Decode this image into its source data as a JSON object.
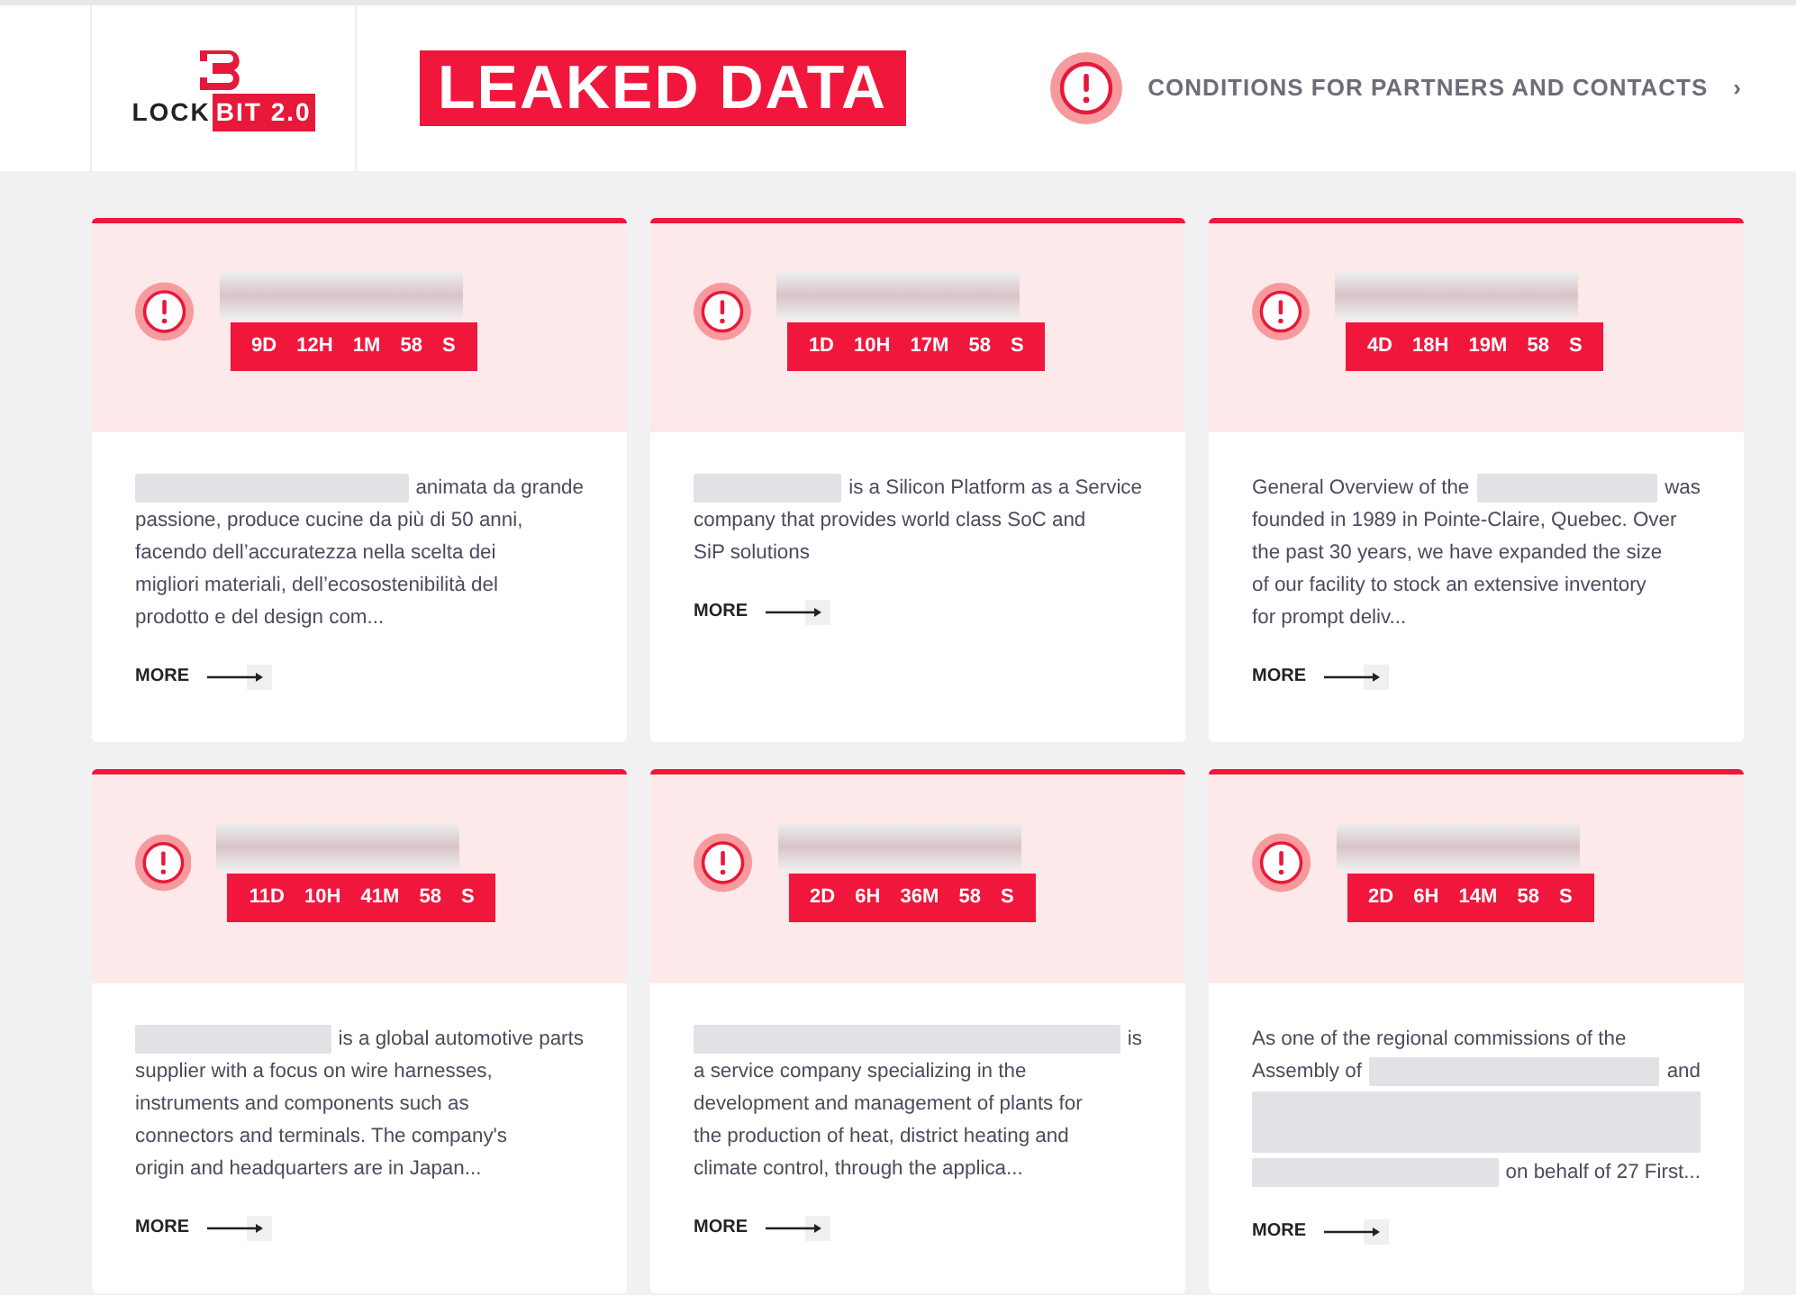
{
  "header": {
    "logo": {
      "text": "LOCK",
      "badge": "BIT 2.0"
    },
    "banner": "LEAKED DATA",
    "link": {
      "label": "CONDITIONS FOR PARTNERS AND CONTACTS",
      "chevron": "›"
    }
  },
  "cards": [
    {
      "timer": "9D 12H 1M 58 S",
      "lines": [
        [
          {
            "kind": "redacted"
          },
          {
            "kind": "text",
            "text": "animata da grande"
          }
        ],
        [
          {
            "kind": "text",
            "text": "passione, produce cucine da più di 50 anni,"
          }
        ],
        [
          {
            "kind": "text",
            "text": "facendo dell’accuratezza nella scelta dei"
          }
        ],
        [
          {
            "kind": "text",
            "text": "migliori materiali, dell’ecosostenibilità del"
          }
        ],
        [
          {
            "kind": "text",
            "text": "prodotto e del design com..."
          }
        ]
      ],
      "more": "MORE"
    },
    {
      "timer": "1D 10H 17M 58 S",
      "lines": [
        [
          {
            "kind": "redacted"
          },
          {
            "kind": "text",
            "text": "is a Silicon Platform as a Service"
          }
        ],
        [
          {
            "kind": "text",
            "text": "company that provides world class SoC and"
          }
        ],
        [
          {
            "kind": "text",
            "text": "SiP solutions"
          }
        ]
      ],
      "more": "MORE"
    },
    {
      "timer": "4D 18H 19M 58 S",
      "lines": [
        [
          {
            "kind": "text",
            "text": "General Overview of the"
          },
          {
            "kind": "redacted"
          },
          {
            "kind": "text",
            "text": "was"
          }
        ],
        [
          {
            "kind": "text",
            "text": "founded in 1989 in Pointe-Claire, Quebec. Over"
          }
        ],
        [
          {
            "kind": "text",
            "text": "the past 30 years, we have expanded the size"
          }
        ],
        [
          {
            "kind": "text",
            "text": "of our facility to stock an extensive inventory"
          }
        ],
        [
          {
            "kind": "text",
            "text": "for prompt deliv..."
          }
        ]
      ],
      "more": "MORE"
    },
    {
      "timer": "11D 10H 41M 58 S",
      "lines": [
        [
          {
            "kind": "redacted"
          },
          {
            "kind": "text",
            "text": "is a global automotive parts"
          }
        ],
        [
          {
            "kind": "text",
            "text": "supplier with a focus on wire harnesses,"
          }
        ],
        [
          {
            "kind": "text",
            "text": "instruments and components such as"
          }
        ],
        [
          {
            "kind": "text",
            "text": "connectors and terminals. The company's"
          }
        ],
        [
          {
            "kind": "text",
            "text": "origin and headquarters are in Japan..."
          }
        ]
      ],
      "more": "MORE"
    },
    {
      "timer": "2D 6H 36M 58 S",
      "lines": [
        [
          {
            "kind": "redacted"
          },
          {
            "kind": "text",
            "text": "is"
          }
        ],
        [
          {
            "kind": "text",
            "text": "a service company specializing in the"
          }
        ],
        [
          {
            "kind": "text",
            "text": "development and management of plants for"
          }
        ],
        [
          {
            "kind": "text",
            "text": "the production of heat, district heating and"
          }
        ],
        [
          {
            "kind": "text",
            "text": "climate control, through the applica..."
          }
        ]
      ],
      "more": "MORE"
    },
    {
      "timer": "2D 6H 14M 58 S",
      "lines": [
        [
          {
            "kind": "text",
            "text": "As one of the regional commissions of the"
          }
        ],
        [
          {
            "kind": "text",
            "text": "Assembly of"
          },
          {
            "kind": "redacted"
          },
          {
            "kind": "text",
            "text": "and"
          }
        ],
        [
          {
            "kind": "redacted"
          }
        ],
        [
          {
            "kind": "redacted"
          },
          {
            "kind": "text",
            "text": "on behalf of 27 First..."
          }
        ]
      ],
      "more": "MORE"
    }
  ]
}
